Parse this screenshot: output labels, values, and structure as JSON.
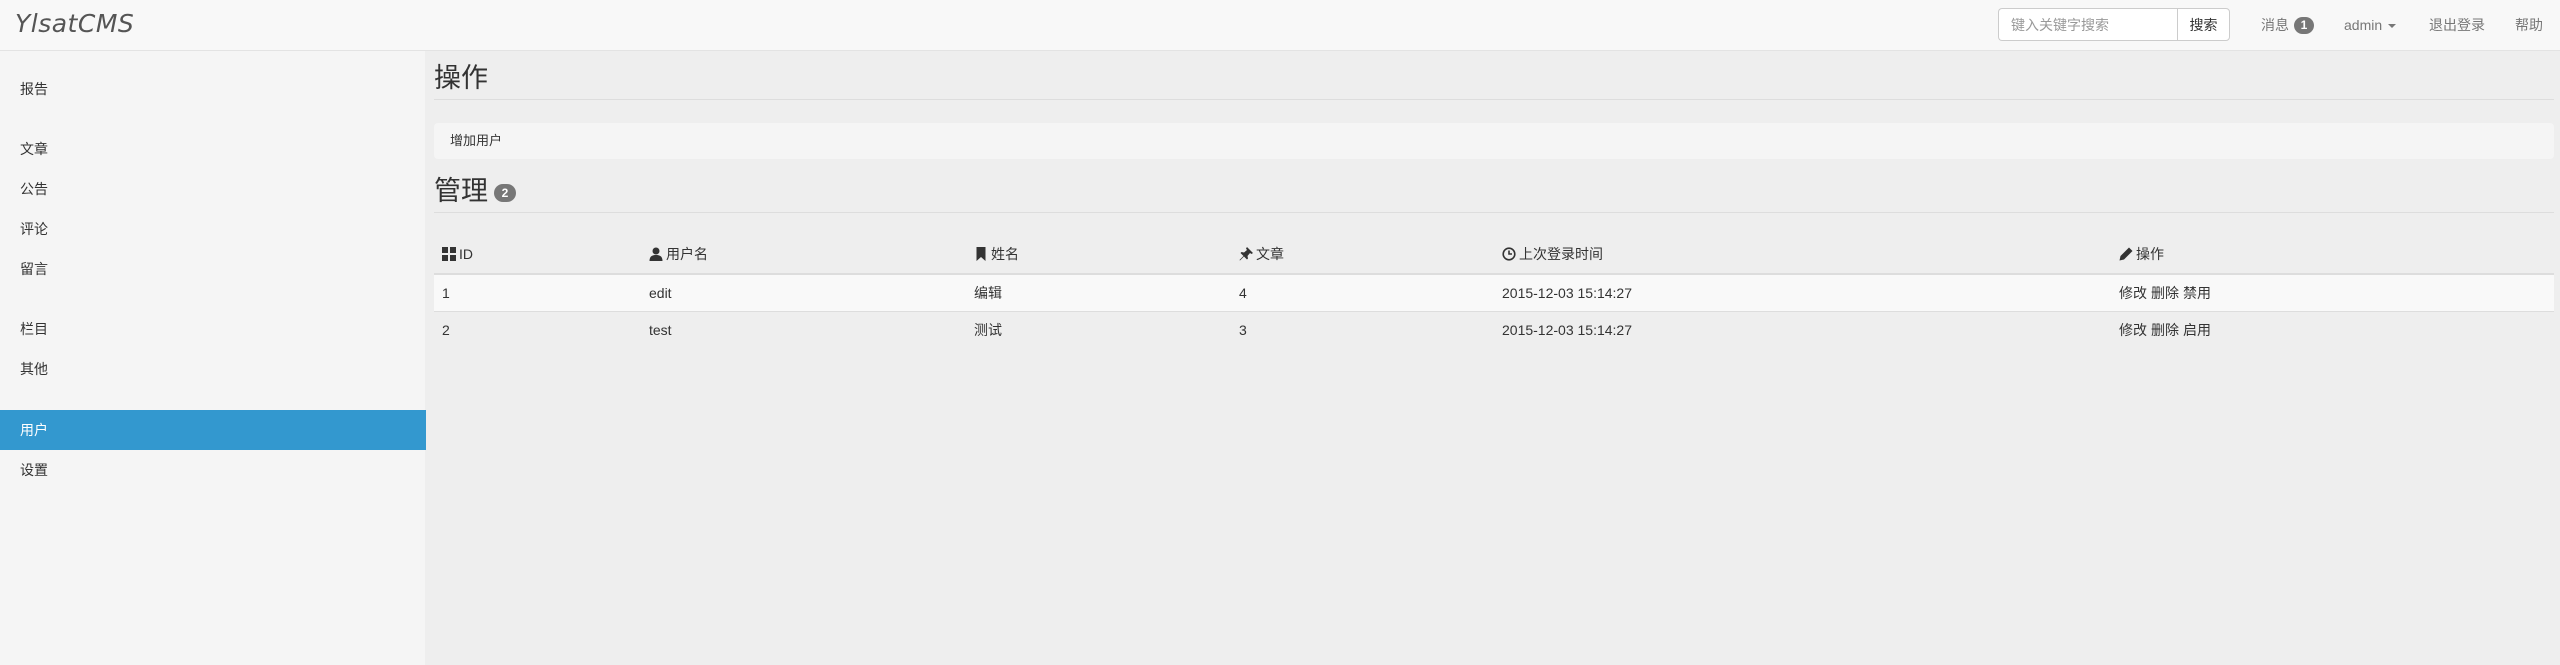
{
  "navbar": {
    "brand": "YlsatCMS",
    "search": {
      "placeholder": "键入关键字搜索",
      "value": "",
      "button_label": "搜索"
    },
    "messages": {
      "label": "消息",
      "count": "1"
    },
    "user_menu": {
      "label": "admin"
    },
    "logout_label": "退出登录",
    "help_label": "帮助"
  },
  "sidebar": {
    "items": [
      {
        "label": "报告",
        "active": false
      },
      {
        "label": "文章",
        "active": false
      },
      {
        "label": "公告",
        "active": false
      },
      {
        "label": "评论",
        "active": false
      },
      {
        "label": "留言",
        "active": false
      },
      {
        "label": "栏目",
        "active": false
      },
      {
        "label": "其他",
        "active": false
      },
      {
        "label": "用户",
        "active": true
      },
      {
        "label": "设置",
        "active": false
      }
    ],
    "active_color": "#3398cf"
  },
  "main": {
    "operations_title": "操作",
    "add_user_label": "增加用户",
    "manage_title": "管理",
    "manage_count": "2",
    "table": {
      "columns": [
        {
          "label": "ID",
          "icon": "th-large-icon"
        },
        {
          "label": "用户名",
          "icon": "user-icon"
        },
        {
          "label": "姓名",
          "icon": "bookmark-icon"
        },
        {
          "label": "文章",
          "icon": "pushpin-icon"
        },
        {
          "label": "上次登录时间",
          "icon": "clock-icon"
        },
        {
          "label": "操作",
          "icon": "pencil-icon"
        }
      ],
      "rows": [
        {
          "id": "1",
          "username": "edit",
          "name": "编辑",
          "articles": "4",
          "last_login": "2015-12-03 15:14:27",
          "actions": [
            "修改",
            "删除",
            "禁用"
          ]
        },
        {
          "id": "2",
          "username": "test",
          "name": "测试",
          "articles": "3",
          "last_login": "2015-12-03 15:14:27",
          "actions": [
            "修改",
            "删除",
            "启用"
          ]
        }
      ]
    }
  }
}
